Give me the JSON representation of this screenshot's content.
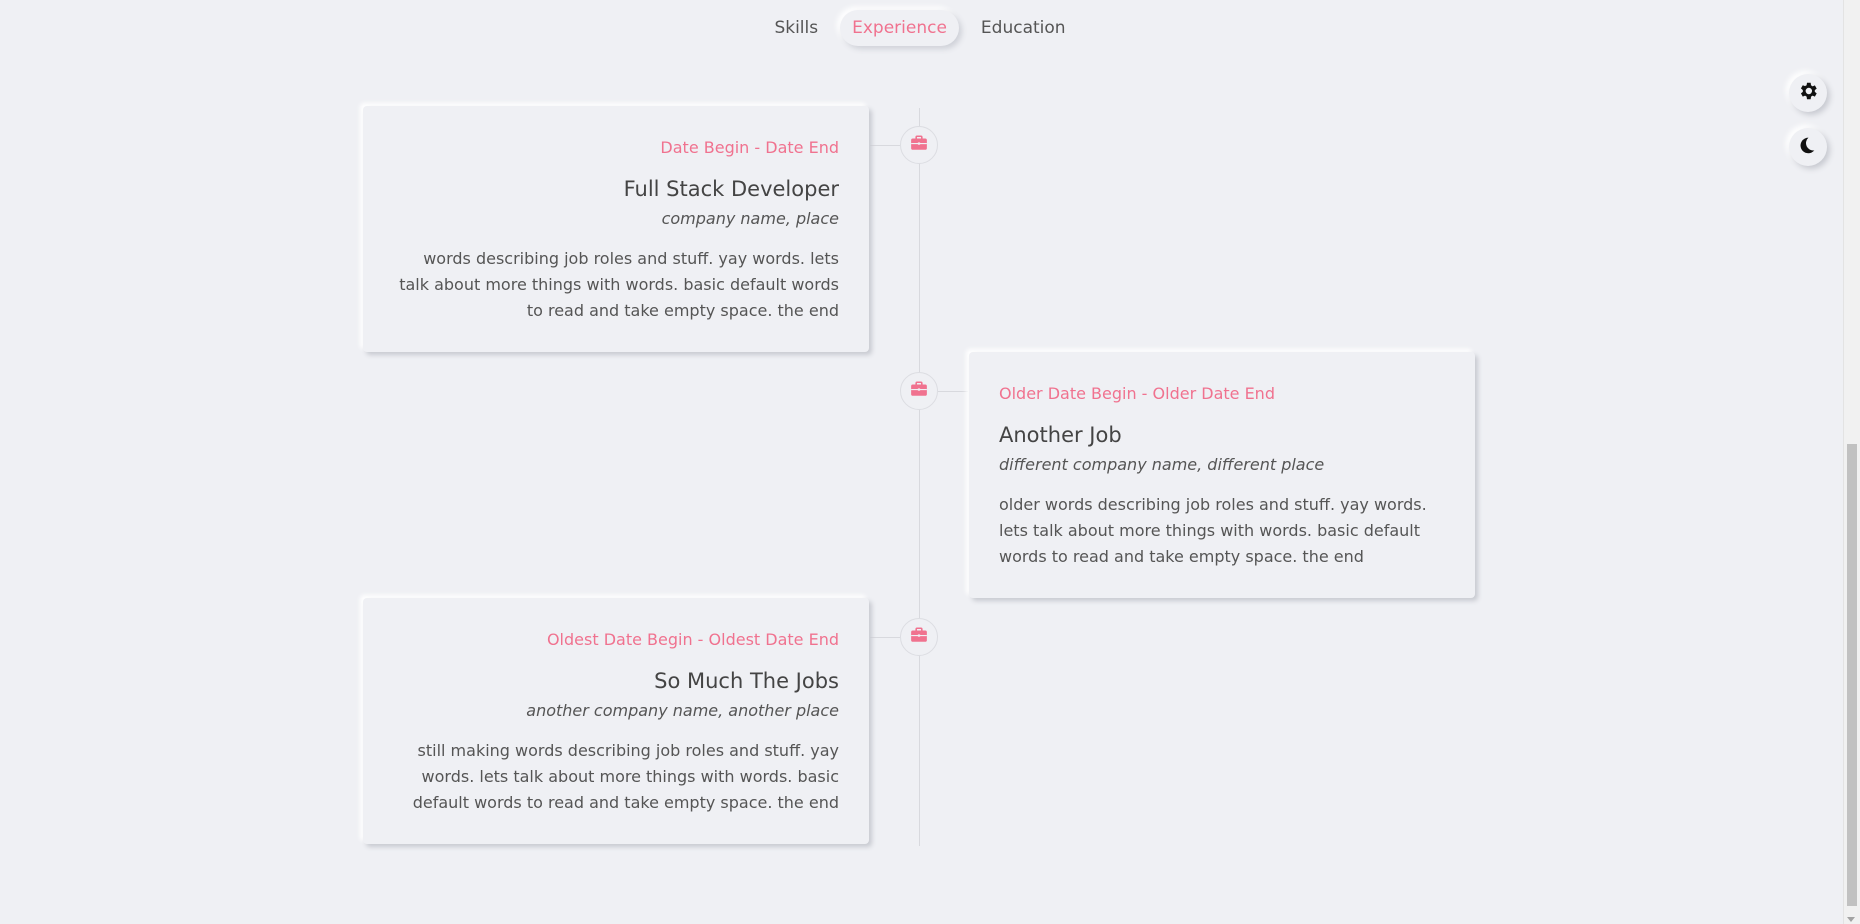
{
  "tabs": [
    {
      "label": "Skills",
      "active": false
    },
    {
      "label": "Experience",
      "active": true
    },
    {
      "label": "Education",
      "active": false
    }
  ],
  "colors": {
    "accent": "#f0728f",
    "background": "#eff0f4",
    "text": "#555555"
  },
  "timeline": [
    {
      "date": "Date Begin - Date End",
      "title": "Full Stack Developer",
      "company": "company name, place",
      "description": "words describing job roles and stuff. yay words. lets talk about more things with words. basic default words to read and take empty space. the end",
      "icon": "briefcase-icon"
    },
    {
      "date": "Older Date Begin - Older Date End",
      "title": "Another Job",
      "company": "different company name, different place",
      "description": "older words describing job roles and stuff. yay words. lets talk about more things with words. basic default words to read and take empty space. the end",
      "icon": "briefcase-icon"
    },
    {
      "date": "Oldest Date Begin - Oldest Date End",
      "title": "So Much The Jobs",
      "company": "another company name, another place",
      "description": "still making words describing job roles and stuff. yay words. lets talk about more things with words. basic default words to read and take empty space. the end",
      "icon": "briefcase-icon"
    }
  ],
  "controls": {
    "settings_icon": "gear-icon",
    "theme_icon": "moon-icon"
  }
}
